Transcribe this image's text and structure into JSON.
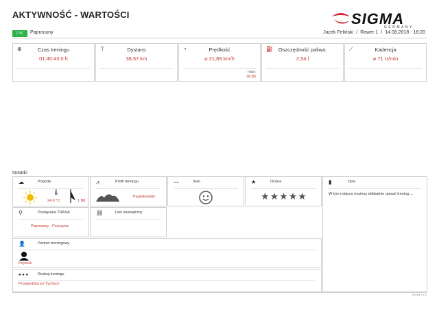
{
  "header": {
    "title": "AKTYWNOŚĆ - WARTOŚCI",
    "logo_text": "SIGMA",
    "logo_sub": "GERMANY",
    "activity_icon": "CYC",
    "activity_label": "Paprocany",
    "user": "Jacek Feliński",
    "bike": "Rower 1",
    "datetime": "14.08.2018 - 16:20",
    "separator": "/"
  },
  "stats": [
    {
      "icon": "clock-icon",
      "label": "Czas treningu",
      "value": "01:45:43.0 h"
    },
    {
      "icon": "distance-flag-icon",
      "label": "Dystans",
      "value": "38,57 km"
    },
    {
      "icon": "speedometer-icon",
      "label": "Prędkość",
      "value": "⌀ 21,89 km/h",
      "max_label": "max:",
      "max_value": "38,85"
    },
    {
      "icon": "fuel-pump-icon",
      "label": "Oszczędność paliwa:",
      "value": "2,54 l"
    },
    {
      "icon": "cadence-icon",
      "label": "Kadencja",
      "value": "⌀ 71 U/min"
    }
  ],
  "notes": {
    "title": "Notatki",
    "weather": {
      "label": "Pogoda",
      "temperature": "24,0 °C",
      "wind": "1 Bft"
    },
    "profile": {
      "label": "Profil treningu",
      "value": "Pagórkowato"
    },
    "state": {
      "label": "Stan"
    },
    "rating": {
      "label": "Ocena",
      "stars": 5
    },
    "description": {
      "label": "Opis",
      "value": "W tym miejscu możesz dokładnie opisać trening ..."
    },
    "route": {
      "label": "Powiązana TRASA",
      "value": "Paprocany - Pszczyna"
    },
    "link": {
      "label": "Link zewnętrzny"
    },
    "partner": {
      "label": "Partner treningowy",
      "value": "Koyocik"
    },
    "type": {
      "label": "Rodzaj treningu",
      "value": "Przejażdżka po Tychach"
    }
  },
  "footer": {
    "page": "Strona 1 z 1"
  }
}
